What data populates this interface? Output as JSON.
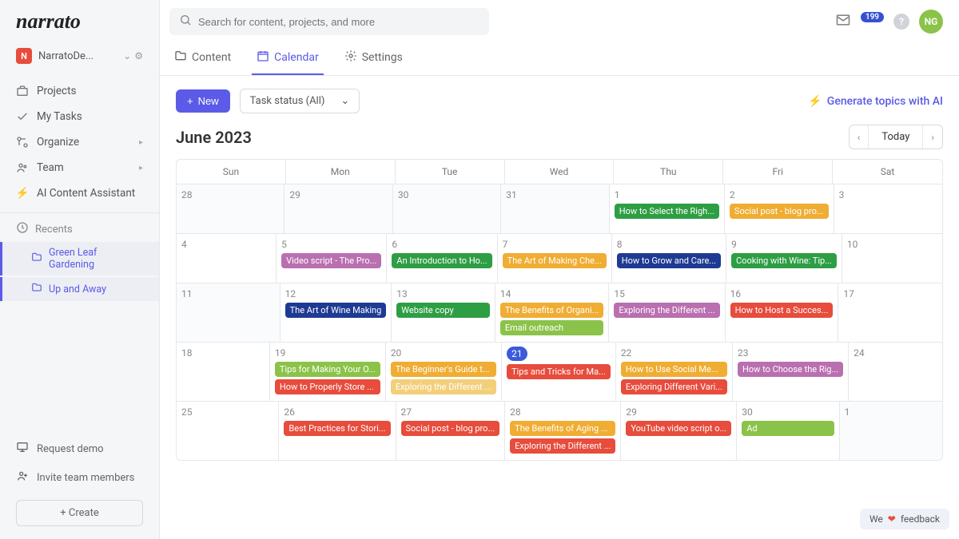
{
  "logo": "narrato",
  "workspace": {
    "badge": "N",
    "name": "NarratoDe...",
    "chevron": "⌄",
    "gear": "⚙"
  },
  "sidebar": {
    "items": [
      {
        "label": "Projects"
      },
      {
        "label": "My Tasks"
      },
      {
        "label": "Organize",
        "expand": true
      },
      {
        "label": "Team",
        "expand": true
      },
      {
        "label": "AI Content Assistant",
        "bolt": true
      }
    ],
    "recents_label": "Recents",
    "recents": [
      {
        "label": "Green Leaf Gardening"
      },
      {
        "label": "Up and Away"
      }
    ],
    "request_demo": "Request demo",
    "invite": "Invite team members",
    "create": "+ Create"
  },
  "search": {
    "placeholder": "Search for content, projects, and more"
  },
  "topbar": {
    "notif_count": "199",
    "avatar": "NG"
  },
  "tabs": [
    {
      "label": "Content"
    },
    {
      "label": "Calendar",
      "active": true
    },
    {
      "label": "Settings"
    }
  ],
  "toolbar": {
    "new_label": "New",
    "filter_label": "Task status (All)",
    "ai_label": "Generate topics with AI"
  },
  "calendar": {
    "month": "June 2023",
    "today_label": "Today",
    "days": [
      "Sun",
      "Mon",
      "Tue",
      "Wed",
      "Thu",
      "Fri",
      "Sat"
    ],
    "weeks": [
      [
        {
          "num": "28",
          "dim": true,
          "events": []
        },
        {
          "num": "29",
          "dim": true,
          "events": []
        },
        {
          "num": "30",
          "dim": true,
          "events": []
        },
        {
          "num": "31",
          "dim": true,
          "events": []
        },
        {
          "num": "1",
          "events": [
            {
              "t": "How to Select the Righ...",
              "c": "#2e9e44"
            }
          ]
        },
        {
          "num": "2",
          "events": [
            {
              "t": "Social post - blog pro...",
              "c": "#f0ad33"
            }
          ]
        },
        {
          "num": "3",
          "events": []
        }
      ],
      [
        {
          "num": "4",
          "events": []
        },
        {
          "num": "5",
          "events": [
            {
              "t": "Video script - The Pro...",
              "c": "#b96fb0"
            }
          ]
        },
        {
          "num": "6",
          "events": [
            {
              "t": "An Introduction to Ho...",
              "c": "#2e9e44"
            }
          ]
        },
        {
          "num": "7",
          "events": [
            {
              "t": "The Art of Making Che...",
              "c": "#f0ad33"
            }
          ]
        },
        {
          "num": "8",
          "events": [
            {
              "t": "How to Grow and Care...",
              "c": "#1f3a93"
            }
          ]
        },
        {
          "num": "9",
          "events": [
            {
              "t": "Cooking with Wine: Tip...",
              "c": "#2e9e44"
            }
          ]
        },
        {
          "num": "10",
          "events": []
        }
      ],
      [
        {
          "num": "11",
          "dim": true,
          "events": []
        },
        {
          "num": "12",
          "events": [
            {
              "t": "The Art of Wine Making",
              "c": "#1f3a93"
            }
          ]
        },
        {
          "num": "13",
          "events": [
            {
              "t": "Website copy",
              "c": "#2e9e44"
            }
          ]
        },
        {
          "num": "14",
          "events": [
            {
              "t": "The Benefits of Organi...",
              "c": "#f0ad33"
            },
            {
              "t": "Email outreach",
              "c": "#8bc34a"
            }
          ]
        },
        {
          "num": "15",
          "events": [
            {
              "t": "Exploring the Different ...",
              "c": "#b96fb0"
            }
          ]
        },
        {
          "num": "16",
          "events": [
            {
              "t": "How to Host a Succes...",
              "c": "#e74c3c"
            }
          ]
        },
        {
          "num": "17",
          "events": []
        }
      ],
      [
        {
          "num": "18",
          "events": []
        },
        {
          "num": "19",
          "events": [
            {
              "t": "Tips for Making Your O...",
              "c": "#8bc34a"
            },
            {
              "t": "How to Properly Store ...",
              "c": "#e74c3c"
            }
          ]
        },
        {
          "num": "20",
          "events": [
            {
              "t": "The Beginner's Guide t...",
              "c": "#f0ad33"
            },
            {
              "t": "Exploring the Different ...",
              "c": "#f3cf7a"
            }
          ]
        },
        {
          "num": "21",
          "today": true,
          "events": [
            {
              "t": "Tips and Tricks for Ma...",
              "c": "#e74c3c"
            }
          ]
        },
        {
          "num": "22",
          "events": [
            {
              "t": "How to Use Social Me...",
              "c": "#f0ad33"
            },
            {
              "t": "Exploring Different Vari...",
              "c": "#e74c3c"
            }
          ]
        },
        {
          "num": "23",
          "events": [
            {
              "t": "How to Choose the Rig...",
              "c": "#b96fb0"
            }
          ]
        },
        {
          "num": "24",
          "events": []
        }
      ],
      [
        {
          "num": "25",
          "events": []
        },
        {
          "num": "26",
          "events": [
            {
              "t": "Best Practices for Stori...",
              "c": "#e74c3c"
            }
          ]
        },
        {
          "num": "27",
          "events": [
            {
              "t": "Social post - blog pro...",
              "c": "#e74c3c"
            }
          ]
        },
        {
          "num": "28",
          "events": [
            {
              "t": "The Benefits of Aging ...",
              "c": "#f0ad33"
            },
            {
              "t": "Exploring the Different ...",
              "c": "#e74c3c"
            }
          ]
        },
        {
          "num": "29",
          "events": [
            {
              "t": "YouTube video script o...",
              "c": "#e74c3c"
            }
          ]
        },
        {
          "num": "30",
          "events": [
            {
              "t": "Ad",
              "c": "#8bc34a"
            }
          ]
        },
        {
          "num": "1",
          "dim": true,
          "events": []
        }
      ]
    ]
  },
  "feedback": {
    "pre": "We",
    "heart": "❤",
    "label": "feedback"
  }
}
